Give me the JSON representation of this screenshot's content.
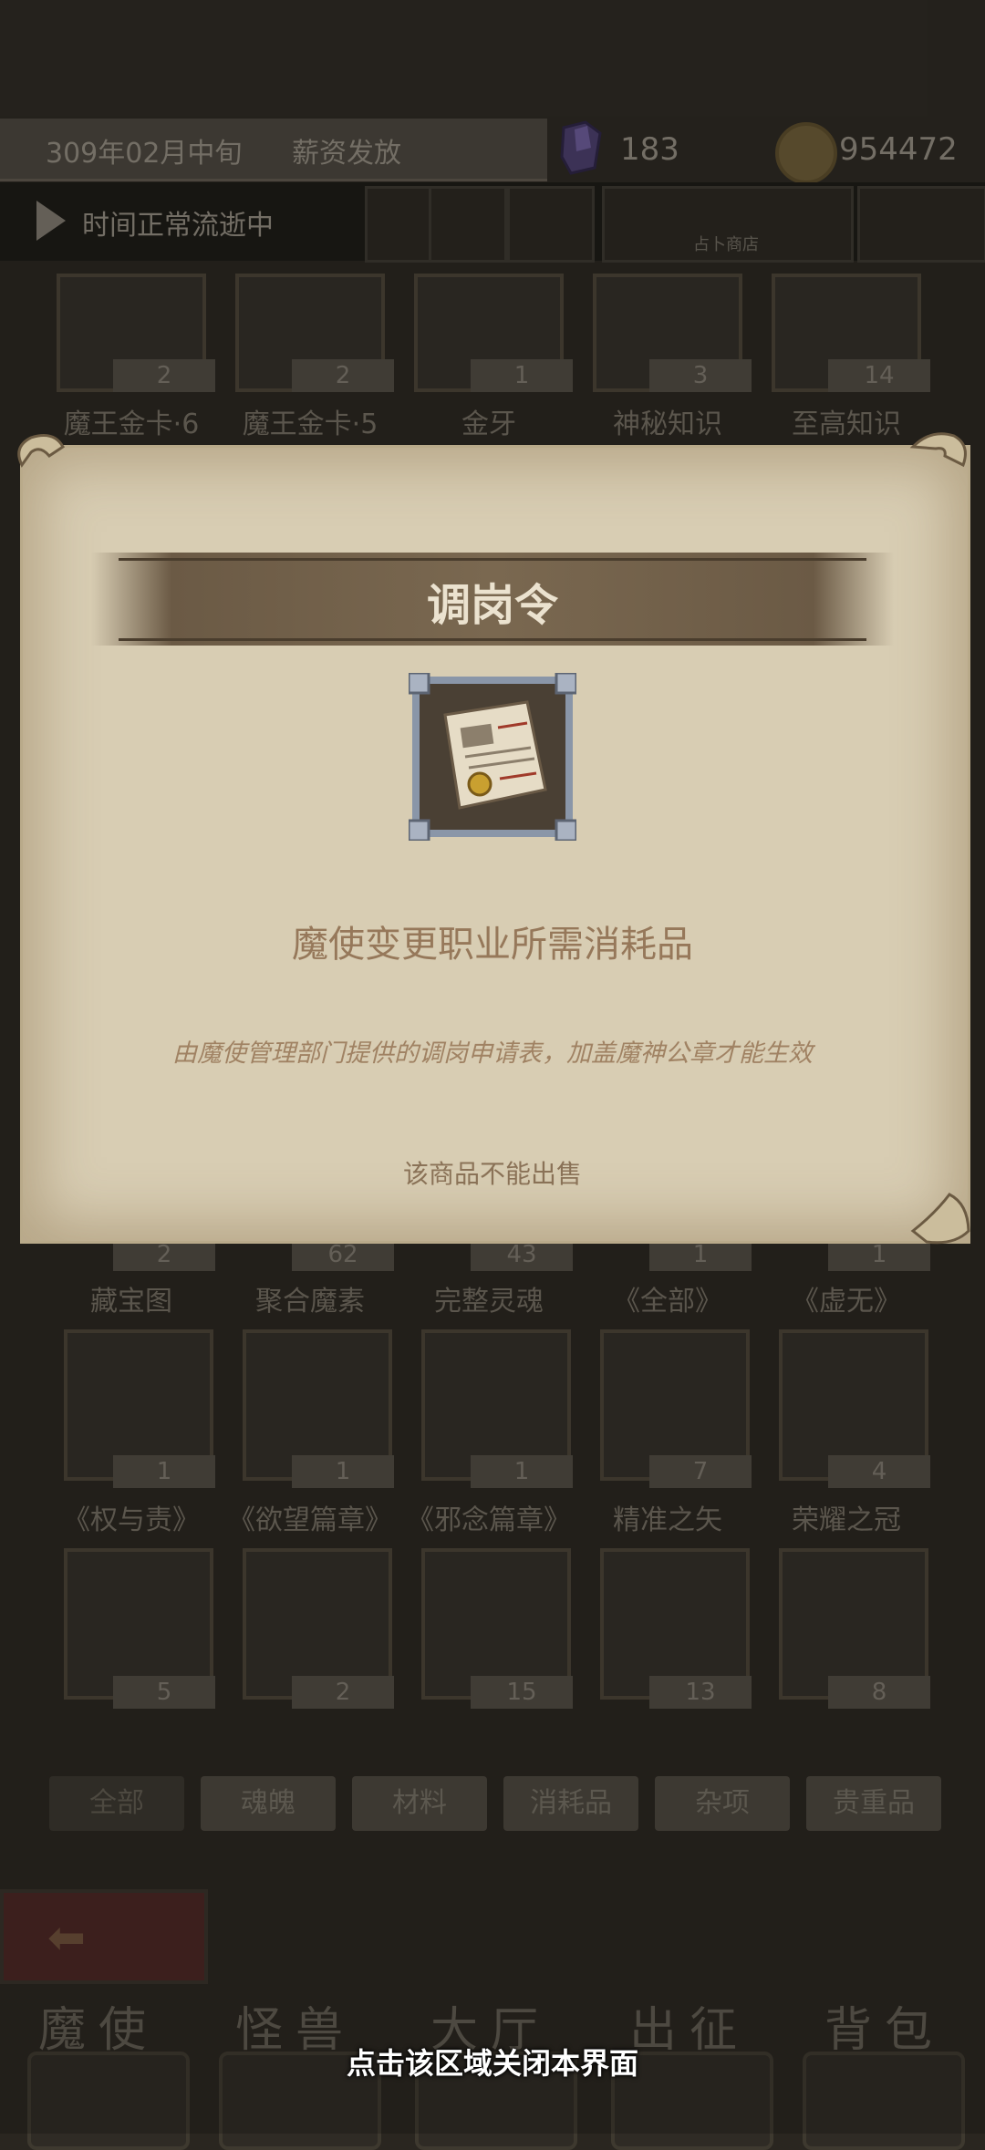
{
  "status": {
    "date": "309年02月中旬",
    "event": "薪资发放",
    "crystals": "183",
    "coins": "954472",
    "time_text": "时间正常流逝中",
    "shop_label": "占卜商店"
  },
  "inventory": {
    "top_row": [
      {
        "count": "2",
        "name": "魔王金卡·6"
      },
      {
        "count": "2",
        "name": "魔王金卡·5"
      },
      {
        "count": "1",
        "name": "金牙"
      },
      {
        "count": "3",
        "name": "神秘知识"
      },
      {
        "count": "14",
        "name": "至高知识"
      }
    ],
    "row2": [
      {
        "count": "2",
        "name": "藏宝图"
      },
      {
        "count": "62",
        "name": "聚合魔素"
      },
      {
        "count": "43",
        "name": "完整灵魂"
      },
      {
        "count": "1",
        "name": "《全部》"
      },
      {
        "count": "1",
        "name": "《虚无》"
      }
    ],
    "row3": [
      {
        "count": "1",
        "name": "《权与责》"
      },
      {
        "count": "1",
        "name": "《欲望篇章》"
      },
      {
        "count": "1",
        "name": "《邪念篇章》"
      },
      {
        "count": "7",
        "name": "精准之矢"
      },
      {
        "count": "4",
        "name": "荣耀之冠"
      }
    ],
    "row4": [
      {
        "count": "5"
      },
      {
        "count": "2"
      },
      {
        "count": "15"
      },
      {
        "count": "13"
      },
      {
        "count": "8"
      }
    ]
  },
  "tabs": [
    "全部",
    "魂魄",
    "材料",
    "消耗品",
    "杂项",
    "贵重品"
  ],
  "nav": [
    "魔使",
    "怪兽",
    "大厅",
    "出征",
    "背包"
  ],
  "dialog": {
    "title": "调岗令",
    "subtitle": "魔使变更职业所需消耗品",
    "description": "由魔使管理部门提供的调岗申请表，加盖魔神公章才能生效",
    "sell_note": "该商品不能出售"
  },
  "close_hint": "点击该区域关闭本界面",
  "colors": {
    "dialog_bg": "#d8cdb3",
    "title_text": "#ebe2cf",
    "desc_text": "#96785a"
  }
}
